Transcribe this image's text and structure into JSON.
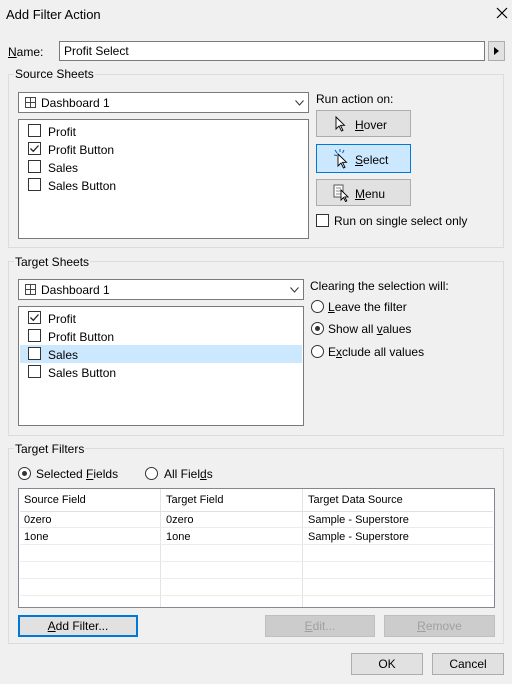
{
  "dialog": {
    "title": "Add Filter Action",
    "close_icon": "close-icon"
  },
  "name": {
    "label": "Name:",
    "value": "Profit Select",
    "menu_icon": "play-arrow-icon"
  },
  "source": {
    "group_label": "Source Sheets",
    "dashboard": "Dashboard 1",
    "sheets": [
      {
        "label": "Profit",
        "checked": false
      },
      {
        "label": "Profit Button",
        "checked": true
      },
      {
        "label": "Sales",
        "checked": false
      },
      {
        "label": "Sales Button",
        "checked": false
      }
    ],
    "run_on_label": "Run action on:",
    "hover_label": "Hover",
    "select_label": "Select",
    "menu_label": "Menu",
    "single_select_label": "Run on single select only",
    "single_select_checked": false
  },
  "target": {
    "group_label": "Target Sheets",
    "dashboard": "Dashboard 1",
    "sheets": [
      {
        "label": "Profit",
        "checked": true
      },
      {
        "label": "Profit Button",
        "checked": false
      },
      {
        "label": "Sales",
        "checked": false,
        "highlighted": true
      },
      {
        "label": "Sales Button",
        "checked": false
      }
    ],
    "clearing_label": "Clearing the selection will:",
    "options": [
      "Leave the filter",
      "Show all values",
      "Exclude all values"
    ],
    "selected_option": "Show all values"
  },
  "filters": {
    "group_label": "Target Filters",
    "selected_fields_label": "Selected Fields",
    "all_fields_label": "All Fields",
    "selected_mode": "Selected Fields",
    "columns": [
      "Source Field",
      "Target Field",
      "Target Data Source"
    ],
    "rows": [
      [
        "0zero",
        "0zero",
        "Sample - Superstore"
      ],
      [
        "1one",
        "1one",
        "Sample - Superstore"
      ]
    ],
    "add_filter_label": "Add Filter...",
    "edit_label": "Edit...",
    "remove_label": "Remove"
  },
  "footer": {
    "ok_label": "OK",
    "cancel_label": "Cancel"
  }
}
